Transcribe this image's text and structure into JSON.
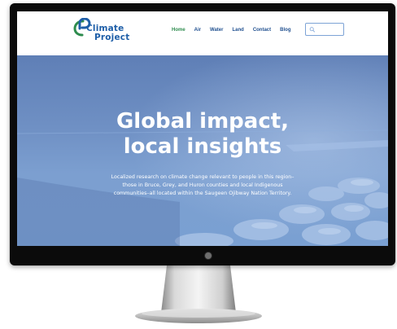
{
  "brand": {
    "name_line1": "Climate",
    "name_line2": "Project",
    "logo_colors": [
      "#2e8c4e",
      "#1f5fa8"
    ]
  },
  "nav": {
    "items": [
      {
        "label": "Home",
        "active": true
      },
      {
        "label": "Air",
        "active": false
      },
      {
        "label": "Water",
        "active": false
      },
      {
        "label": "Land",
        "active": false
      },
      {
        "label": "Contact",
        "active": false
      },
      {
        "label": "Blog",
        "active": false
      }
    ],
    "active_color": "#2e8c4e",
    "link_color": "#1f4f8f"
  },
  "search": {
    "icon": "search-icon",
    "placeholder": ""
  },
  "hero": {
    "title_line1": "Global impact,",
    "title_line2": "local insights",
    "description": "Localized research on climate change relevant to people in this region–those in Bruce, Grey, and Huron counties and local Indigenous communities–all located within the Saugeen Ojibway Nation Territory.",
    "overlay_color": "#6f90c4"
  },
  "device": {
    "type": "desktop-monitor",
    "camera_icon": "camera-dot-icon"
  }
}
